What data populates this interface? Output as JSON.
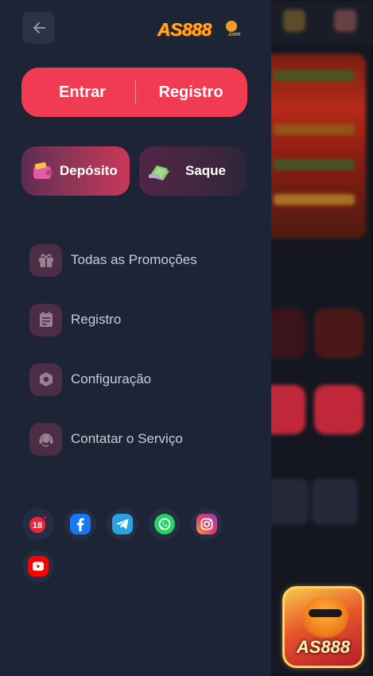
{
  "drawer": {
    "logo": {
      "text": "AS888",
      "sub": ".com"
    },
    "auth": {
      "login_label": "Entrar",
      "register_label": "Registro"
    },
    "wallet": {
      "deposit_label": "Depósito",
      "withdraw_label": "Saque"
    },
    "menu": [
      {
        "label": "Todas as Promoções",
        "icon": "gift-icon"
      },
      {
        "label": "Registro",
        "icon": "record-list-icon"
      },
      {
        "label": "Configuração",
        "icon": "settings-hexagon-icon"
      },
      {
        "label": "Contatar o Serviço",
        "icon": "headset-icon"
      }
    ],
    "socials": [
      {
        "name": "18+",
        "icon": "age-18-plus-icon",
        "color": "#e8283a"
      },
      {
        "name": "Facebook",
        "icon": "facebook-icon",
        "color": "#1877f2"
      },
      {
        "name": "Telegram",
        "icon": "telegram-icon",
        "color": "#2aa3df"
      },
      {
        "name": "WhatsApp",
        "icon": "whatsapp-icon",
        "color": "#25d366"
      },
      {
        "name": "Instagram",
        "icon": "instagram-icon",
        "color": "#d62976"
      },
      {
        "name": "YouTube",
        "icon": "youtube-icon",
        "color": "#ff0000"
      }
    ]
  },
  "promo_widget": {
    "brand": "AS888"
  },
  "colors": {
    "drawer_bg": "#1c2436",
    "accent": "#f03b53",
    "menu_icon_bg": "#4b2e46",
    "text": "#c9ccd6"
  }
}
